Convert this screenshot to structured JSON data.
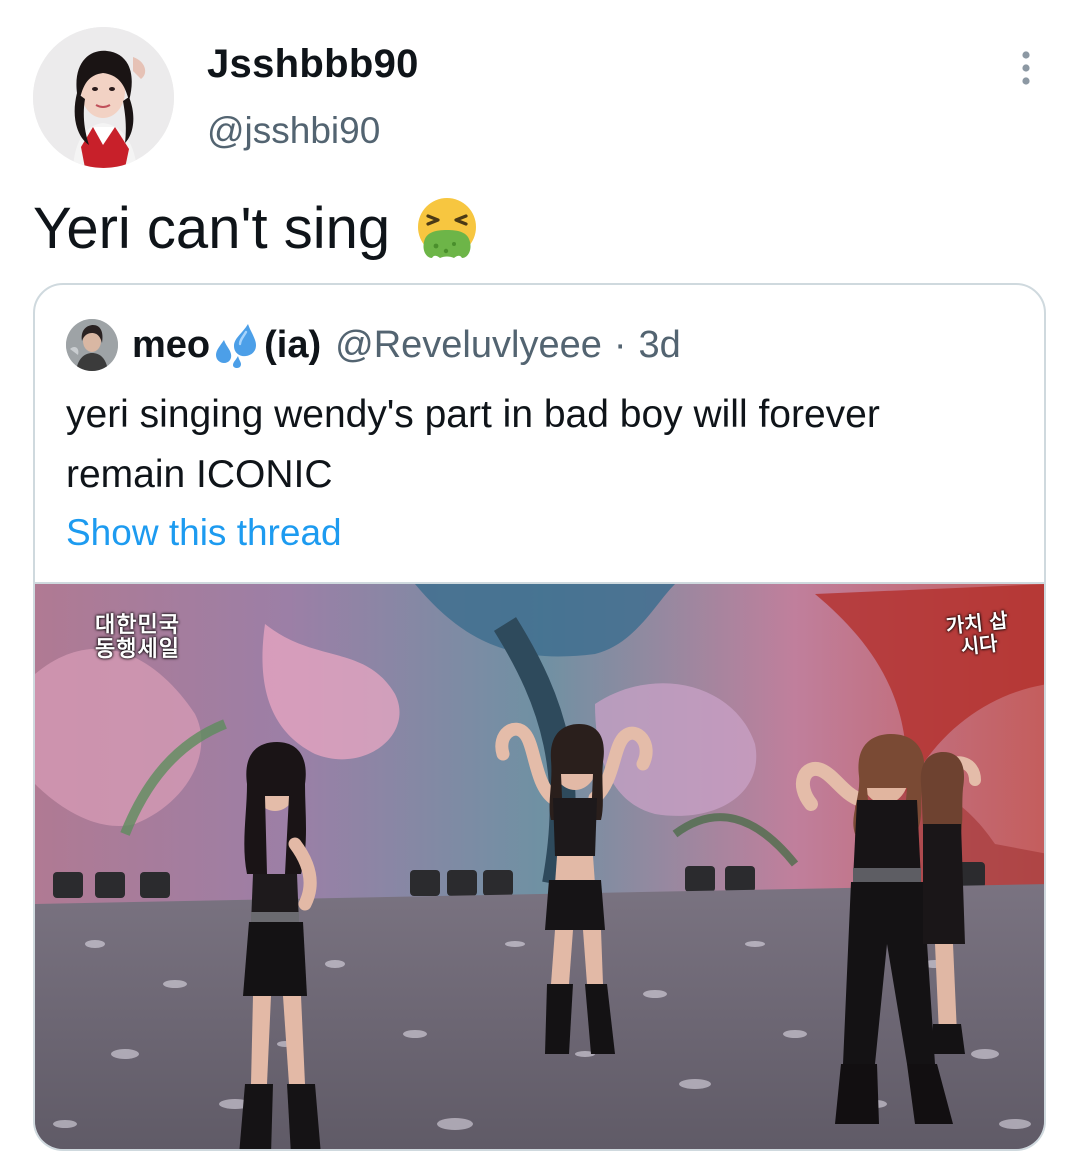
{
  "tweet": {
    "author": {
      "display_name": "Jsshbbb90",
      "handle": "@jsshbi90",
      "avatar_icon": "profile-photo"
    },
    "more_icon": "more-vertical-icon",
    "text": "Yeri can't sing",
    "emoji": "vomiting-face-emoji"
  },
  "quoted_tweet": {
    "author": {
      "name_prefix": "meo",
      "name_emoji": "sweat-droplets-emoji",
      "name_suffix": "(ia)",
      "handle": "@Reveluvlyeee",
      "separator": "·",
      "time": "3d"
    },
    "text": "yeri singing wendy's part in bad boy will forever remain ICONIC",
    "show_thread_label": "Show this thread",
    "media": {
      "overlay_left": "대한민국 동행세일",
      "overlay_right": "가치 삽시다"
    }
  },
  "colors": {
    "text_primary": "#0f1419",
    "text_secondary": "#536471",
    "link": "#1d9bf0",
    "border": "#cfd9de"
  }
}
